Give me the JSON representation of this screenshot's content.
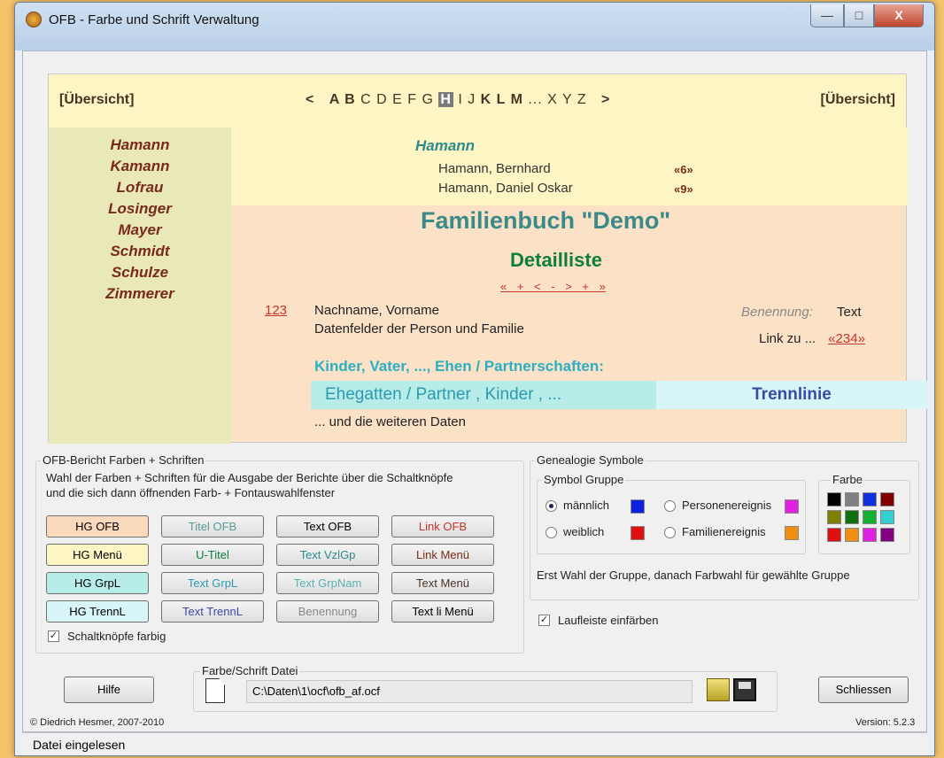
{
  "window": {
    "title": "OFB - Farbe und Schrift Verwaltung",
    "controls": {
      "minimize": "—",
      "maximize": "□",
      "close": "X"
    }
  },
  "preview": {
    "overview_left": "[Übersicht]",
    "overview_right": "[Übersicht]",
    "nav_prev": "<",
    "nav_next": ">",
    "letters_bold_1": "A B",
    "letters_1": " C D E F G ",
    "letter_current": "H",
    "letters_2": " I J ",
    "letters_bold_2": "K L M",
    "letters_3": " ... X Y Z",
    "side_names": [
      "Hamann",
      "Kamann",
      "Lofrau",
      "Losinger",
      "Mayer",
      "Schmidt",
      "Schulze",
      "Zimmerer"
    ],
    "family_heading": "Hamann",
    "entries": [
      {
        "name": "Hamann, Bernhard",
        "ref": "«6»"
      },
      {
        "name": "Hamann, Daniel Oskar",
        "ref": "«9»"
      }
    ],
    "book_title": "Familienbuch \"Demo\"",
    "list_title": "Detailliste",
    "list_nav": "« + < - > + »",
    "person_number": "123",
    "line_name": "Nachname, Vorname",
    "line_fields": "Datenfelder der Person und Familie",
    "benennung_label": "Benennung:",
    "benennung_text": "Text",
    "link_label": "Link zu ...",
    "link_value": "«234»",
    "children_heading": "Kinder, Vater, ..., Ehen / Partnerschaften:",
    "group_line": "Ehegatten / Partner , Kinder , ...",
    "separator_line": "Trennlinie",
    "more_data": "... und die weiteren Daten"
  },
  "report_group": {
    "label": "OFB-Bericht Farben + Schriften",
    "description": "Wahl der Farben + Schriften für die Ausgabe der Berichte über die Schaltknöpfe und die sich dann öffnenden Farb- + Fontauswahlfenster",
    "buttons": [
      [
        "HG OFB",
        "Titel OFB",
        "Text OFB",
        "Link OFB"
      ],
      [
        "HG Menü",
        "U-Titel",
        "Text VzlGp",
        "Link Menü"
      ],
      [
        "HG GrpL",
        "Text GrpL",
        "Text GrpNam",
        "Text Menü"
      ],
      [
        "HG TrennL",
        "Text TrennL",
        "Benennung",
        "Text li Menü"
      ]
    ],
    "colored_buttons_label": "Schaltknöpfe farbig",
    "colored_buttons_checked": true
  },
  "genealogy_group": {
    "label": "Genealogie Symbole",
    "symbol_group_label": "Symbol Gruppe",
    "options": [
      {
        "label": "männlich",
        "selected": true,
        "color": "#1020e0"
      },
      {
        "label": "weiblich",
        "selected": false,
        "color": "#e01010"
      },
      {
        "label": "Personenereignis",
        "selected": false,
        "color": "#e020e0"
      },
      {
        "label": "Familienereignis",
        "selected": false,
        "color": "#f09010"
      }
    ],
    "palette_label": "Farbe",
    "palette": [
      "#000000",
      "#808080",
      "#1030e0",
      "#800000",
      "#808000",
      "#107010",
      "#10b030",
      "#30d0d0",
      "#e01010",
      "#f09010",
      "#e020e0",
      "#800080"
    ],
    "hint": "Erst Wahl der Gruppe, danach Farbwahl für gewählte Gruppe",
    "scrollbar_label": "Laufleiste einfärben",
    "scrollbar_checked": true
  },
  "file_group": {
    "label": "Farbe/Schrift Datei",
    "path": "C:\\Daten\\1\\ocf\\ofb_af.ocf"
  },
  "buttons": {
    "help": "Hilfe",
    "close": "Schliessen"
  },
  "footer": {
    "copyright": "© Diedrich Hesmer, 2007-2010",
    "version": "Version: 5.2.3"
  },
  "status": {
    "text": "Datei eingelesen"
  },
  "colors": {
    "btn_hg_ofb": "#fbd9bd",
    "btn_hg_menu": "#fdf6c4",
    "btn_hg_grpl": "#b8ece8",
    "btn_hg_trennl": "#d8f6f7",
    "text_titel": "#5a9a9a",
    "text_utitel": "#0e7f3c",
    "text_link": "#c3342a",
    "text_grpl": "#2c9ab0",
    "text_trennl": "#3b4aa8",
    "text_benennung": "#888888"
  }
}
